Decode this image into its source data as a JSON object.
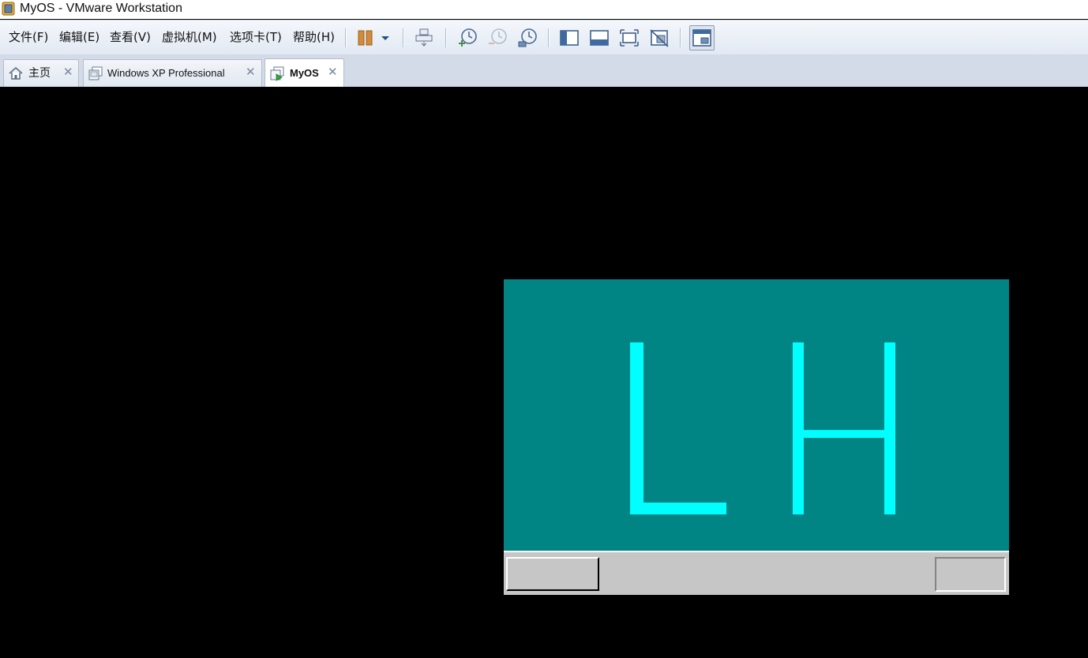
{
  "window": {
    "title": "MyOS - VMware Workstation"
  },
  "menu": [
    "文件(F)",
    "编辑(E)",
    "查看(V)",
    "虚拟机(M)",
    "选项卡(T)",
    "帮助(H)"
  ],
  "toolbar": {
    "buttons": [
      "pause-icon",
      "pause-dropdown-icon",
      "send-ctrl-alt-del-icon",
      "take-snapshot-icon",
      "revert-snapshot-icon",
      "snapshot-manager-icon",
      "show-library-icon",
      "show-thumbnail-bar-icon",
      "full-screen-icon",
      "unity-icon",
      "console-view-icon"
    ],
    "accent_color": "#d28b3c",
    "icon_color": "#4a6a93"
  },
  "tabs": [
    {
      "label": "主页",
      "icon": "home-icon",
      "active": false,
      "close": "✕"
    },
    {
      "label": "Windows XP Professional",
      "icon": "vm-icon",
      "active": false,
      "close": "✕"
    },
    {
      "label": "MyOS",
      "icon": "vm-running-icon",
      "active": true,
      "close": "✕"
    }
  ],
  "guest": {
    "desktop_color": "#008484",
    "glyph_color": "#00ffff",
    "taskbar_color": "#c6c6c6",
    "glyphs": [
      "L",
      "H"
    ]
  }
}
